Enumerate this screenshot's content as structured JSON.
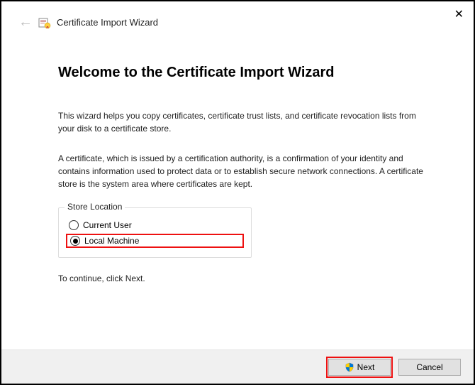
{
  "window": {
    "title": "Certificate Import Wizard"
  },
  "page": {
    "heading": "Welcome to the Certificate Import Wizard",
    "intro1": "This wizard helps you copy certificates, certificate trust lists, and certificate revocation lists from your disk to a certificate store.",
    "intro2": "A certificate, which is issued by a certification authority, is a confirmation of your identity and contains information used to protect data or to establish secure network connections. A certificate store is the system area where certificates are kept.",
    "continue": "To continue, click Next."
  },
  "storeLocation": {
    "legend": "Store Location",
    "options": {
      "currentUser": "Current User",
      "localMachine": "Local Machine"
    },
    "selected": "localMachine"
  },
  "buttons": {
    "next": "Next",
    "cancel": "Cancel"
  }
}
